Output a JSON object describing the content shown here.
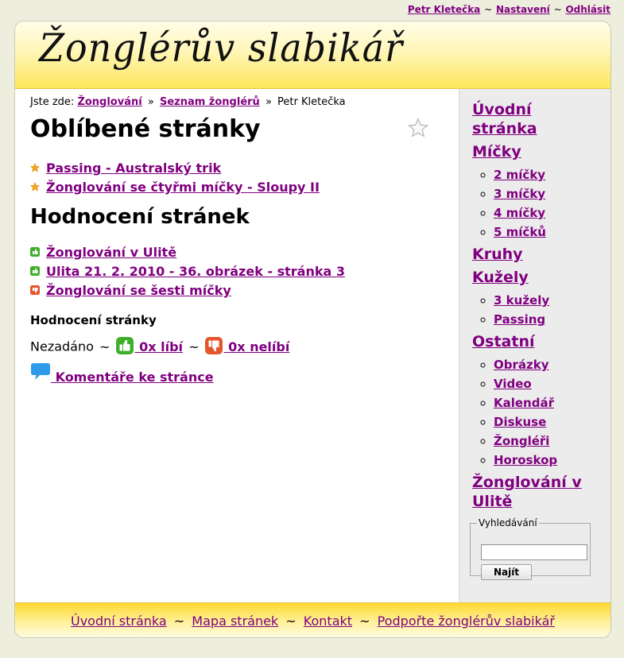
{
  "userbar": {
    "user": "Petr Kletečka",
    "settings": "Nastavení",
    "logout": "Odhlásit",
    "sep": "~"
  },
  "header": {
    "logo": "Žonglérův slabikář"
  },
  "breadcrumb": {
    "label": "Jste zde:",
    "items": [
      "Žonglování",
      "Seznam žonglérů"
    ],
    "current": "Petr Kletečka",
    "sep": "»"
  },
  "favorites": {
    "title": "Oblíbené stránky",
    "items": [
      "Passing - Australský trik",
      "Žonglování se čtyřmi míčky - Sloupy II"
    ]
  },
  "ratings": {
    "title": "Hodnocení stránek",
    "items": [
      {
        "label": "Žonglování v Ulitě",
        "status": "like"
      },
      {
        "label": "Ulita 21. 2. 2010 - 36. obrázek - stránka 3",
        "status": "like"
      },
      {
        "label": "Žonglování se šesti míčky",
        "status": "dislike"
      }
    ]
  },
  "page_rating": {
    "title": "Hodnocení stránky",
    "state": "Nezadáno",
    "sep": "~",
    "like": " 0x líbí",
    "dislike": " 0x nelíbí"
  },
  "comments": {
    "label": " Komentáře ke stránce"
  },
  "sidebar": {
    "home": "Úvodní stránka",
    "balls": "Míčky",
    "balls_items": [
      "2 míčky",
      "3 míčky",
      "4 míčky",
      "5 míčků"
    ],
    "rings": "Kruhy",
    "clubs": "Kužely",
    "clubs_items": [
      "3 kužely",
      "Passing"
    ],
    "other": "Ostatní",
    "other_items": [
      "Obrázky",
      "Video",
      "Kalendář",
      "Diskuse",
      "Žongléři",
      "Horoskop"
    ],
    "ulita": "Žonglování v Ulitě"
  },
  "search": {
    "legend": "Vyhledávání",
    "value": "",
    "button": "Najít"
  },
  "footer": {
    "links": [
      "Úvodní stránka",
      "Mapa stránek",
      "Kontakt",
      "Podpořte žonglérův slabikář"
    ],
    "sep": "~"
  },
  "colors": {
    "link": "#800080",
    "like": "#3fae2a",
    "dislike": "#e4572e",
    "header_yellow": "#fde65a",
    "sidebar_bg": "#ececec"
  }
}
